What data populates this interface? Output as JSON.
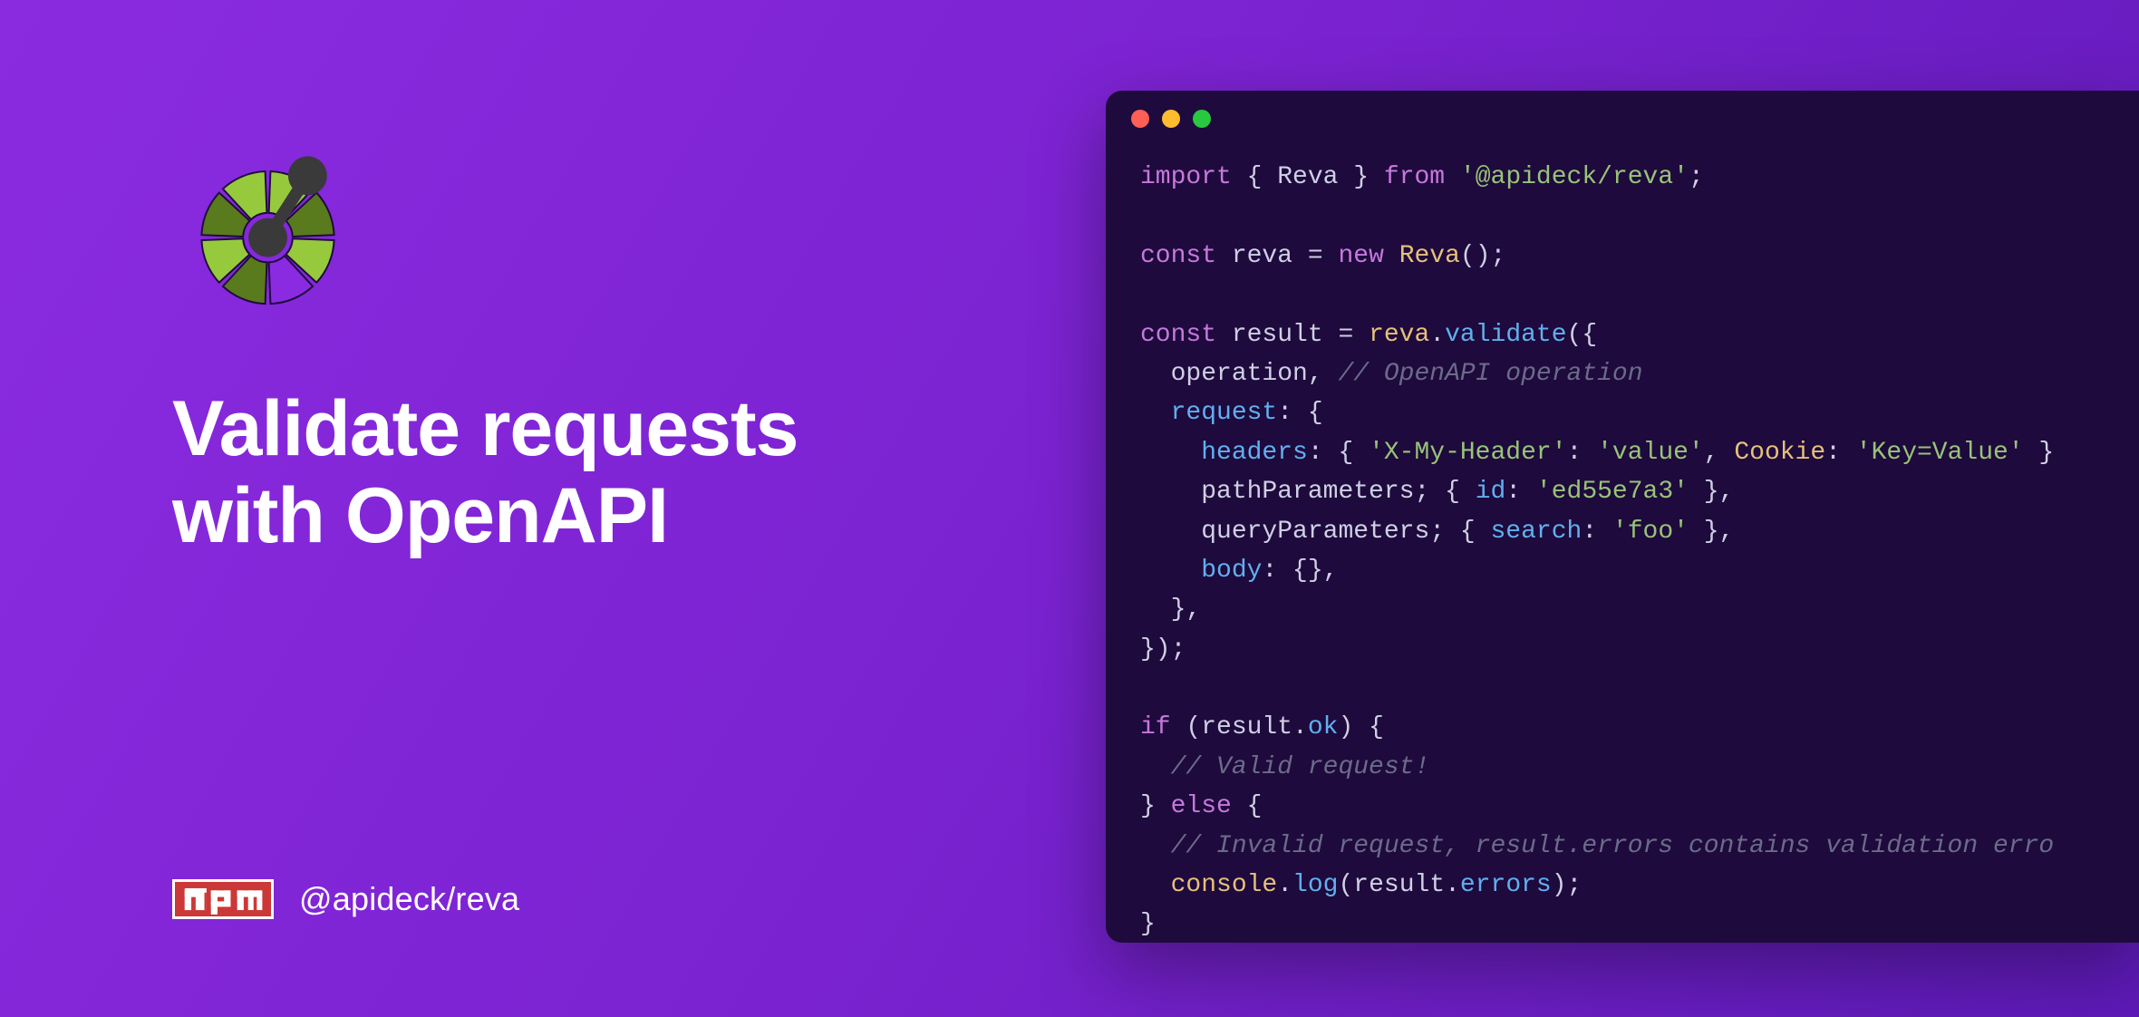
{
  "heading_line1": "Validate requests",
  "heading_line2": "with OpenAPI",
  "npm_label": "npm",
  "package_name": "@apideck/reva",
  "window": {
    "dots": [
      "red",
      "yellow",
      "green"
    ]
  },
  "code": {
    "tokens": [
      [
        [
          "kw",
          "import"
        ],
        [
          "pun",
          " { "
        ],
        [
          "ident",
          "Reva"
        ],
        [
          "pun",
          " } "
        ],
        [
          "kw",
          "from"
        ],
        [
          "pun",
          " "
        ],
        [
          "str",
          "'@apideck/reva'"
        ],
        [
          "pun",
          ";"
        ]
      ],
      [],
      [
        [
          "kw",
          "const"
        ],
        [
          "pun",
          " "
        ],
        [
          "ident",
          "reva"
        ],
        [
          "pun",
          " = "
        ],
        [
          "kw",
          "new"
        ],
        [
          "pun",
          " "
        ],
        [
          "cls",
          "Reva"
        ],
        [
          "pun",
          "();"
        ]
      ],
      [],
      [
        [
          "kw",
          "const"
        ],
        [
          "pun",
          " "
        ],
        [
          "ident",
          "result"
        ],
        [
          "pun",
          " = "
        ],
        [
          "cls",
          "reva"
        ],
        [
          "pun",
          "."
        ],
        [
          "prop",
          "validate"
        ],
        [
          "pun",
          "({"
        ]
      ],
      [
        [
          "pun",
          "  "
        ],
        [
          "ident",
          "operation"
        ],
        [
          "pun",
          ", "
        ],
        [
          "cmt",
          "// OpenAPI operation"
        ]
      ],
      [
        [
          "pun",
          "  "
        ],
        [
          "prop",
          "request"
        ],
        [
          "pun",
          ": {"
        ]
      ],
      [
        [
          "pun",
          "    "
        ],
        [
          "prop",
          "headers"
        ],
        [
          "pun",
          ": { "
        ],
        [
          "str",
          "'X-My-Header'"
        ],
        [
          "pun",
          ": "
        ],
        [
          "str",
          "'value'"
        ],
        [
          "pun",
          ", "
        ],
        [
          "cls",
          "Cookie"
        ],
        [
          "pun",
          ": "
        ],
        [
          "str",
          "'Key=Value'"
        ],
        [
          "pun",
          " }"
        ]
      ],
      [
        [
          "pun",
          "    "
        ],
        [
          "ident",
          "pathParameters"
        ],
        [
          "pun",
          "; { "
        ],
        [
          "prop",
          "id"
        ],
        [
          "pun",
          ": "
        ],
        [
          "str",
          "'ed55e7a3'"
        ],
        [
          "pun",
          " },"
        ]
      ],
      [
        [
          "pun",
          "    "
        ],
        [
          "ident",
          "queryParameters"
        ],
        [
          "pun",
          "; { "
        ],
        [
          "prop",
          "search"
        ],
        [
          "pun",
          ": "
        ],
        [
          "str",
          "'foo'"
        ],
        [
          "pun",
          " },"
        ]
      ],
      [
        [
          "pun",
          "    "
        ],
        [
          "prop",
          "body"
        ],
        [
          "pun",
          ": {},"
        ]
      ],
      [
        [
          "pun",
          "  },"
        ]
      ],
      [
        [
          "pun",
          "});"
        ]
      ],
      [],
      [
        [
          "kw",
          "if"
        ],
        [
          "pun",
          " ("
        ],
        [
          "ident",
          "result"
        ],
        [
          "pun",
          "."
        ],
        [
          "prop",
          "ok"
        ],
        [
          "pun",
          ") {"
        ]
      ],
      [
        [
          "pun",
          "  "
        ],
        [
          "cmt",
          "// Valid request!"
        ]
      ],
      [
        [
          "pun",
          "} "
        ],
        [
          "kw",
          "else"
        ],
        [
          "pun",
          " {"
        ]
      ],
      [
        [
          "pun",
          "  "
        ],
        [
          "cmt",
          "// Invalid request, result.errors contains validation erro"
        ]
      ],
      [
        [
          "pun",
          "  "
        ],
        [
          "cls",
          "console"
        ],
        [
          "pun",
          "."
        ],
        [
          "prop",
          "log"
        ],
        [
          "pun",
          "("
        ],
        [
          "ident",
          "result"
        ],
        [
          "pun",
          "."
        ],
        [
          "prop",
          "errors"
        ],
        [
          "pun",
          ");"
        ]
      ],
      [
        [
          "pun",
          "}"
        ]
      ]
    ]
  },
  "logo": {
    "segments": [
      "#97c93d",
      "#5a7a1e",
      "#97c93d",
      "#8a2be2",
      "#5a7a1e",
      "#97c93d",
      "#5a7a1e",
      "#97c93d"
    ],
    "node_color": "#3a3a3a",
    "link_color": "#3a3a3a"
  }
}
